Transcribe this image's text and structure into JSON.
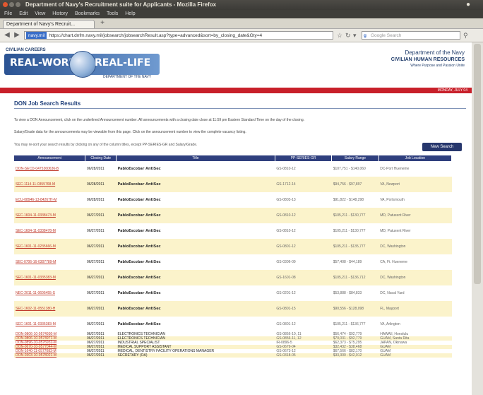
{
  "browser": {
    "window_title": "Department of Navy's Recruitment suite for Applicants - Mozilla Firefox",
    "menu": [
      "File",
      "Edit",
      "View",
      "History",
      "Bookmarks",
      "Tools",
      "Help"
    ],
    "tab_label": "Department of Navy's Recruit...",
    "new_tab": "+",
    "url_badge": "navy.mil",
    "url": "https://chart.dnfm.navy.mil/jobsearch/jobsearchResult.asp?type=advanced&sort=by_closing_date&Gty=4",
    "search_placeholder": "Google Search"
  },
  "header": {
    "logo_top": "CIVILIAN CAREERS",
    "logo_left": "REAL-WORLD",
    "logo_right": "REAL-LIFE",
    "logo_sub": "DEPARTMENT OF THE NAVY",
    "dept1": "Department of the Navy",
    "dept2": "CIVILIAN HUMAN RESOURCES",
    "dept3": "Where Purpose and Passion Unite"
  },
  "rednav": {
    "items": [
      "Home",
      "|",
      "Search for Jobs",
      "|",
      "Applicant Help",
      "|",
      "Applicant Information"
    ],
    "right": "MONDAY, JULY 04"
  },
  "content": {
    "section_title": "DON Job Search Results",
    "para1": "To view a DON Announcement, click on the underlined Announcement number. All announcements with a closing date close at 11:59 pm Eastern Standard Time on the day of the closing.",
    "para2": "Salary/Grade data for the announcements may be viewable from this page. Click on the announcement number to view the complete vacancy listing.",
    "hint": "You may re-sort your search results by clicking on any of the column titles, except PP-SERIES-GR and Salary/Grade.",
    "new_search": "New Search"
  },
  "table": {
    "columns": [
      "Announcement",
      "Closing Date",
      "Title",
      "PP-SERIES-GR",
      "Salary Range",
      "Job Location"
    ],
    "rows": [
      {
        "ann": "DON-SECD-0475360636-B",
        "date": "06/28/2011",
        "title": "PabloEscobar AntiSec",
        "pp": "GS-0810-12",
        "salary": "$107,751 - $140,060",
        "loc": "DC-Port Hueneme"
      },
      {
        "ann": "SEC-1114-11-0355768-M",
        "date": "06/28/2011",
        "title": "PabloEscobar AntiSec",
        "pp": "GS-1712-14",
        "salary": "$94,756 - $97,897",
        "loc": "VA, Newport"
      },
      {
        "ann": "ECU-08946-13-84267H-M",
        "date": "06/28/2011",
        "title": "PabloEscobar AntiSec",
        "pp": "GS-0803-13",
        "salary": "$91,822 - $148,298",
        "loc": "VA, Portsmouth"
      },
      {
        "ann": "SEC-1604-11-0338473-M",
        "date": "06/27/2011",
        "title": "PabloEscobar AntiSec",
        "pp": "GS-0810-12",
        "salary": "$105,211 - $130,777",
        "loc": "MD, Patuxent River"
      },
      {
        "ann": "SEC-1604-11-0338478-M",
        "date": "06/27/2011",
        "title": "PabloEscobar AntiSec",
        "pp": "GS-0810-12",
        "salary": "$105,211 - $130,777",
        "loc": "MD, Patuxent River"
      },
      {
        "ann": "SEC-1601-11-0235666-M",
        "date": "06/27/2011",
        "title": "PabloEscobar AntiSec",
        "pp": "GS-0801-12",
        "salary": "$105,211 - $135,777",
        "loc": "DC, Washington"
      },
      {
        "ann": "SEC-0706-16-0307789-M",
        "date": "06/27/2011",
        "title": "PabloEscobar AntiSec",
        "pp": "GS-0306-09",
        "salary": "$57,408 - $44,189",
        "loc": "CA, Ft. Hueneme"
      },
      {
        "ann": "SEC-1601-11-0335383-M",
        "date": "06/27/2011",
        "title": "PabloEscobar AntiSec",
        "pp": "GS-1601-08",
        "salary": "$105,211 - $136,712",
        "loc": "DC, Washington"
      },
      {
        "ann": "NEC-2011-11-0605455-S",
        "date": "06/27/2011",
        "title": "PabloEscobar AntiSec",
        "pp": "GS-0201-12",
        "salary": "$53,888 - $84,833",
        "loc": "DC, Naval Yard"
      },
      {
        "ann": "SEC-1602-11-0551380-H",
        "date": "06/27/2011",
        "title": "PabloEscobar AntiSec",
        "pp": "GS-0801-15",
        "salary": "$90,556 - $128,098",
        "loc": "FL, Mayport"
      },
      {
        "ann": "SEC-1601-11-0335383-M",
        "date": "06/27/2011",
        "title": "PabloEscobar AntiSec",
        "pp": "GS-0801-12",
        "salary": "$105,211 - $136,777",
        "loc": "VA, Arlington"
      }
    ],
    "small_rows": [
      {
        "ann": "DON-0806-10-0574930-M",
        "date": "06/27/2011",
        "title": "ELECTRONICS TECHNICIAN",
        "pp": "GS-0856-10, 11",
        "salary": "$56,474 - $92,779",
        "loc": "HAWAII, Honolulu"
      },
      {
        "ann": "DON-0806-10-0574971-M",
        "date": "06/27/2011",
        "title": "ELECTRONICS TECHNICIAN",
        "pp": "GS-0856-11, 12",
        "salary": "$70,031 - $92,779",
        "loc": "GUAM, Santa Rita"
      },
      {
        "ann": "DON-0896-10-0576932-M",
        "date": "06/27/2011",
        "title": "INDUSTRIAL SPECIALIST",
        "pp": "IR-0896-5",
        "salary": "$62,373 - $75,295",
        "loc": "JAPAN, Okinawa"
      },
      {
        "ann": "DON-0670-10-0577044-M",
        "date": "06/27/2011",
        "title": "MEDICAL SUPPORT ASSISTANT",
        "pp": "GS-0679-04",
        "salary": "$32,432 - $38,468",
        "loc": "GUAM"
      },
      {
        "ann": "DON-1640-11-0577083-M",
        "date": "06/27/2011",
        "title": "MEDICAL, DENTISTRY FACILITY OPERATIONS MANAGER",
        "pp": "GS-0673-12",
        "salary": "$67,566 - $82,170",
        "loc": "GUAM"
      },
      {
        "ann": "DON-0303-10-0578021-M",
        "date": "06/27/2011",
        "title": "SECRETARY (OA)",
        "pp": "GS-0318-05",
        "salary": "$33,300 - $42,012",
        "loc": "GUAM"
      }
    ]
  }
}
